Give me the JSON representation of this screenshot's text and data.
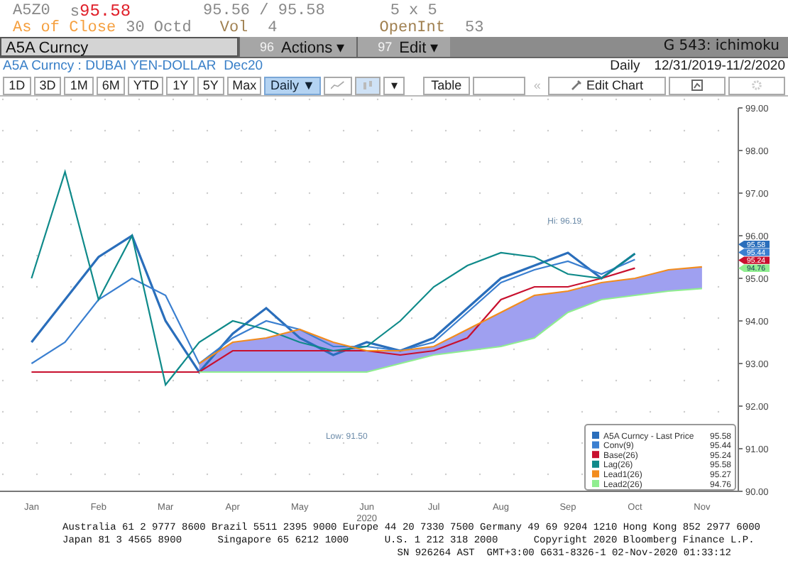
{
  "quote": {
    "ticker": "A5Z0",
    "price_prefix": "s",
    "price": "95.58",
    "bid_ask": "95.56 / 95.58",
    "size": "5 x 5"
  },
  "close": {
    "label": "As of Close",
    "date": "30 Octd",
    "vol_label": "Vol",
    "vol": "4",
    "oi_label": "OpenInt",
    "oi": "53"
  },
  "command_bar": {
    "security": "A5A Curncy",
    "menus": [
      {
        "number": "96",
        "label": "Actions ▾"
      },
      {
        "number": "97",
        "label": "Edit ▾"
      }
    ],
    "page": "G 543: ichimoku"
  },
  "title_bar": {
    "security": "A5A Curncy : DUBAI YEN-DOLLAR  Dec20",
    "period": "Daily",
    "range": "12/31/2019-11/2/2020"
  },
  "toolbar": {
    "ranges": [
      {
        "label": "1D",
        "selected": false
      },
      {
        "label": "3D",
        "selected": false
      },
      {
        "label": "1M",
        "selected": false
      },
      {
        "label": "6M",
        "selected": false
      },
      {
        "label": "YTD",
        "selected": false
      },
      {
        "label": "1Y",
        "selected": false
      },
      {
        "label": "5Y",
        "selected": false
      },
      {
        "label": "Max",
        "selected": false
      }
    ],
    "frequency": {
      "label": "Daily ▼",
      "selected": true
    },
    "chart_type_menu": "▾",
    "table": "Table",
    "back": "«",
    "edit_chart": "Edit Chart"
  },
  "chart": {
    "chart_data": {
      "type": "line",
      "xlabel": "2020",
      "categories": [
        "Jan",
        null,
        "Feb",
        null,
        "Mar",
        null,
        "Apr",
        null,
        "May",
        null,
        "Jun",
        null,
        "Jul",
        null,
        "Aug",
        null,
        "Sep",
        null,
        "Oct",
        null,
        "Nov"
      ],
      "series": [
        {
          "name": "A5A Curncy - Last Price",
          "color": "#2a6ebb",
          "values": [
            93.5,
            94.5,
            95.5,
            96,
            94,
            92.8,
            93.7,
            94.3,
            93.6,
            93.2,
            93.5,
            93.3,
            93.6,
            94.3,
            95,
            95.3,
            95.6,
            95,
            95.58,
            null,
            null
          ]
        },
        {
          "name": "Conv(9)",
          "color": "#3a7fd0",
          "values": [
            93,
            93.5,
            94.5,
            95,
            94.6,
            93,
            93.6,
            94,
            93.8,
            93.4,
            93.4,
            93.3,
            93.5,
            94.2,
            94.9,
            95.2,
            95.4,
            95.1,
            95.44,
            null,
            null
          ]
        },
        {
          "name": "Base(26)",
          "color": "#c8102e",
          "values": [
            92.8,
            92.8,
            92.8,
            92.8,
            92.8,
            92.8,
            93.3,
            93.3,
            93.3,
            93.3,
            93.3,
            93.2,
            93.3,
            93.6,
            94.5,
            94.8,
            94.8,
            95,
            95.24,
            null,
            null
          ]
        },
        {
          "name": "Lag(26)",
          "color": "#0f8a8a",
          "values": [
            95,
            97.5,
            94.5,
            96,
            92.5,
            93.5,
            94,
            93.8,
            93.5,
            93.3,
            93.4,
            94,
            94.8,
            95.3,
            95.6,
            95.5,
            95.1,
            95,
            95.58,
            null,
            null
          ]
        },
        {
          "name": "Lead1(26)",
          "color": "#f28c1e",
          "values": [
            null,
            null,
            null,
            null,
            null,
            93,
            93.5,
            93.6,
            93.8,
            93.5,
            93.3,
            93.3,
            93.4,
            93.8,
            94.2,
            94.6,
            94.7,
            94.9,
            95,
            95.2,
            95.27
          ]
        },
        {
          "name": "Lead2(26)",
          "color": "#90ee90",
          "values": [
            null,
            null,
            null,
            null,
            null,
            92.8,
            92.8,
            92.8,
            92.8,
            92.8,
            92.8,
            93,
            93.2,
            93.3,
            93.4,
            93.6,
            94.2,
            94.5,
            94.6,
            94.7,
            94.76
          ]
        }
      ],
      "ylim": [
        90,
        99
      ],
      "legend": "lower right",
      "yticks": [
        {
          "value": 99,
          "label": "99.00"
        },
        {
          "value": 98,
          "label": "98.00"
        },
        {
          "value": 97,
          "label": "97.00"
        },
        {
          "value": 96,
          "label": "96.00"
        },
        {
          "value": 95,
          "label": "95.00"
        },
        {
          "value": 94,
          "label": "94.00"
        },
        {
          "value": 93,
          "label": "93.00"
        },
        {
          "value": 92,
          "label": "92.00"
        },
        {
          "value": 91,
          "label": "91.00"
        },
        {
          "value": 90,
          "label": "90.00"
        }
      ],
      "annotations": [
        "Hi: 96.19",
        "Low: 91.50"
      ]
    },
    "axis_flags": [
      {
        "text": "95.58",
        "color": "#2a6ebb"
      },
      {
        "text": "95.44",
        "color": "#3a7fd0"
      },
      {
        "text": "95.24",
        "color": "#c8102e"
      },
      {
        "text": "94.76",
        "color": "#90ee90"
      }
    ],
    "legend_values": [
      "95.58",
      "95.44",
      "95.24",
      "95.58",
      "95.27",
      "94.76"
    ]
  },
  "footer": [
    "Australia 61 2 9777 8600 Brazil 5511 2395 9000 Europe 44 20 7330 7500 Germany 49 69 9204 1210 Hong Kong 852 2977 6000",
    "Japan 81 3 4565 8900      Singapore 65 6212 1000      U.S. 1 212 318 2000      Copyright 2020 Bloomberg Finance L.P.",
    "SN 926264 AST  GMT+3:00 G631-8326-1 02-Nov-2020 01:33:12"
  ]
}
